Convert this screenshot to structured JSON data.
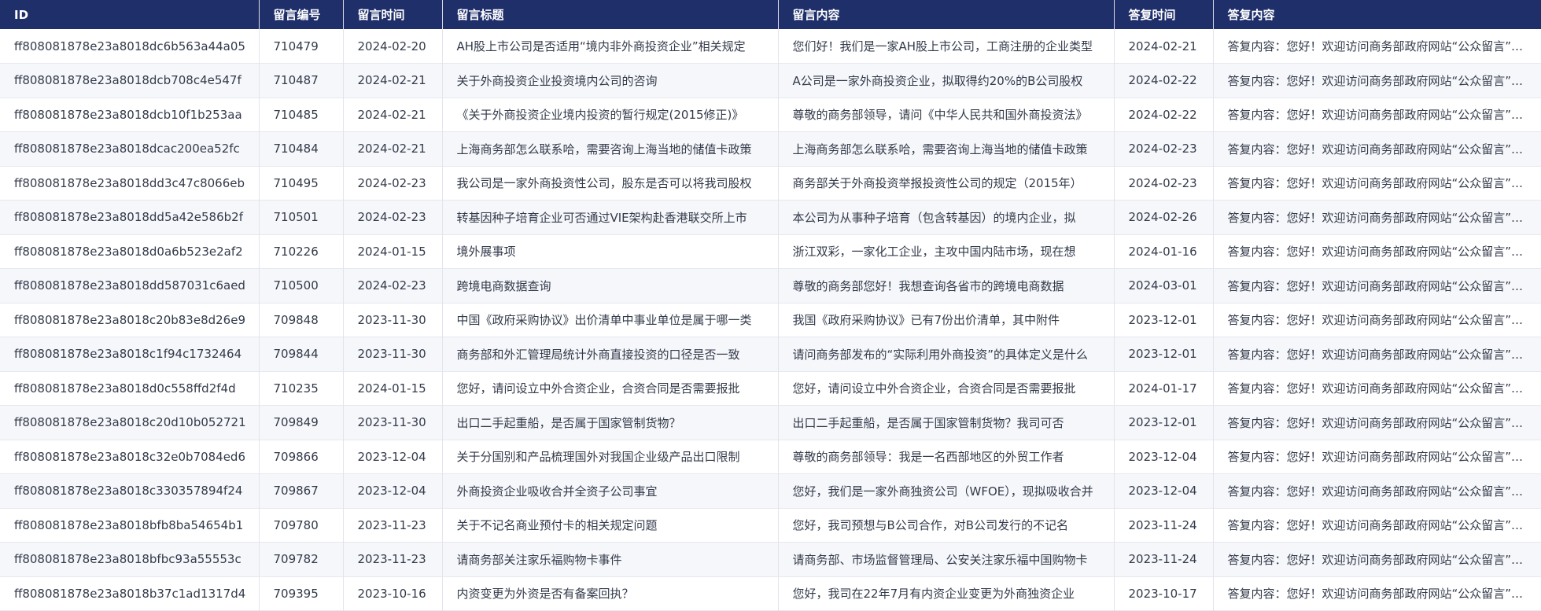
{
  "table": {
    "columns": [
      "ID",
      "留言编号",
      "留言时间",
      "留言标题",
      "留言内容",
      "答复时间",
      "答复内容"
    ],
    "rows": [
      [
        "ff808081878e23a8018dc6b563a44a05",
        "710479",
        "2024-02-20",
        "AH股上市公司是否适用“境内非外商投资企业”相关规定",
        "您们好！我们是一家AH股上市公司，工商注册的企业类型",
        "2024-02-21",
        "答复内容：您好！欢迎访问商务部政府网站“公众留言”栏目"
      ],
      [
        "ff808081878e23a8018dcb708c4e547f",
        "710487",
        "2024-02-21",
        "关于外商投资企业投资境内公司的咨询",
        "A公司是一家外商投资企业，拟取得约20%的B公司股权",
        "2024-02-22",
        "答复内容：您好！欢迎访问商务部政府网站“公众留言”栏目"
      ],
      [
        "ff808081878e23a8018dcb10f1b253aa",
        "710485",
        "2024-02-21",
        "《关于外商投资企业境内投资的暂行规定(2015修正)》",
        "尊敬的商务部领导，请问《中华人民共和国外商投资法》",
        "2024-02-22",
        "答复内容：您好！欢迎访问商务部政府网站“公众留言”栏目"
      ],
      [
        "ff808081878e23a8018dcac200ea52fc",
        "710484",
        "2024-02-21",
        "上海商务部怎么联系哈，需要咨询上海当地的储值卡政策",
        "上海商务部怎么联系哈，需要咨询上海当地的储值卡政策",
        "2024-02-23",
        "答复内容：您好！欢迎访问商务部政府网站“公众留言”栏目"
      ],
      [
        "ff808081878e23a8018dd3c47c8066eb",
        "710495",
        "2024-02-23",
        "我公司是一家外商投资性公司，股东是否可以将我司股权",
        "商务部关于外商投资举报投资性公司的规定（2015年）",
        "2024-02-23",
        "答复内容：您好！欢迎访问商务部政府网站“公众留言”栏目"
      ],
      [
        "ff808081878e23a8018dd5a42e586b2f",
        "710501",
        "2024-02-23",
        "转基因种子培育企业可否通过VIE架构赴香港联交所上市",
        "本公司为从事种子培育（包含转基因）的境内企业，拟",
        "2024-02-26",
        "答复内容：您好！欢迎访问商务部政府网站“公众留言”栏目"
      ],
      [
        "ff808081878e23a8018d0a6b523e2af2",
        "710226",
        "2024-01-15",
        "境外展事项",
        "浙江双彩，一家化工企业，主攻中国内陆市场，现在想",
        "2024-01-16",
        "答复内容：您好！欢迎访问商务部政府网站“公众留言”栏目"
      ],
      [
        "ff808081878e23a8018dd587031c6aed",
        "710500",
        "2024-02-23",
        "跨境电商数据查询",
        "尊敬的商务部您好！我想查询各省市的跨境电商数据",
        "2024-03-01",
        "答复内容：您好！欢迎访问商务部政府网站“公众留言”栏目"
      ],
      [
        "ff808081878e23a8018c20b83e8d26e9",
        "709848",
        "2023-11-30",
        "中国《政府采购协议》出价清单中事业单位是属于哪一类",
        "我国《政府采购协议》已有7份出价清单，其中附件",
        "2023-12-01",
        "答复内容：您好！欢迎访问商务部政府网站“公众留言”栏目"
      ],
      [
        "ff808081878e23a8018c1f94c1732464",
        "709844",
        "2023-11-30",
        "商务部和外汇管理局统计外商直接投资的口径是否一致",
        "请问商务部发布的“实际利用外商投资”的具体定义是什么",
        "2023-12-01",
        "答复内容：您好！欢迎访问商务部政府网站“公众留言”栏目"
      ],
      [
        "ff808081878e23a8018d0c558ffd2f4d",
        "710235",
        "2024-01-15",
        "您好，请问设立中外合资企业，合资合同是否需要报批",
        "您好，请问设立中外合资企业，合资合同是否需要报批",
        "2024-01-17",
        "答复内容：您好！欢迎访问商务部政府网站“公众留言”栏目"
      ],
      [
        "ff808081878e23a8018c20d10b052721",
        "709849",
        "2023-11-30",
        "出口二手起重船，是否属于国家管制货物？",
        "出口二手起重船，是否属于国家管制货物？我司可否",
        "2023-12-01",
        "答复内容：您好！欢迎访问商务部政府网站“公众留言”栏目"
      ],
      [
        "ff808081878e23a8018c32e0b7084ed6",
        "709866",
        "2023-12-04",
        "关于分国别和产品梳理国外对我国企业级产品出口限制",
        "尊敬的商务部领导：我是一名西部地区的外贸工作者",
        "2023-12-04",
        "答复内容：您好！欢迎访问商务部政府网站“公众留言”栏目"
      ],
      [
        "ff808081878e23a8018c330357894f24",
        "709867",
        "2023-12-04",
        "外商投资企业吸收合并全资子公司事宜",
        "您好，我们是一家外商独资公司（WFOE），现拟吸收合并",
        "2023-12-04",
        "答复内容：您好！欢迎访问商务部政府网站“公众留言”栏目"
      ],
      [
        "ff808081878e23a8018bfb8ba54654b1",
        "709780",
        "2023-11-23",
        "关于不记名商业预付卡的相关规定问题",
        "您好，我司预想与B公司合作，对B公司发行的不记名",
        "2023-11-24",
        "答复内容：您好！欢迎访问商务部政府网站“公众留言”栏目"
      ],
      [
        "ff808081878e23a8018bfbc93a55553c",
        "709782",
        "2023-11-23",
        "请商务部关注家乐福购物卡事件",
        "请商务部、市场监督管理局、公安关注家乐福中国购物卡",
        "2023-11-24",
        "答复内容：您好！欢迎访问商务部政府网站“公众留言”栏目"
      ],
      [
        "ff808081878e23a8018b37c1ad1317d4",
        "709395",
        "2023-10-16",
        "内资变更为外资是否有备案回执？",
        "您好，我司在22年7月有内资企业变更为外商独资企业",
        "2023-10-17",
        "答复内容：您好！欢迎访问商务部政府网站“公众留言”栏目"
      ]
    ]
  }
}
